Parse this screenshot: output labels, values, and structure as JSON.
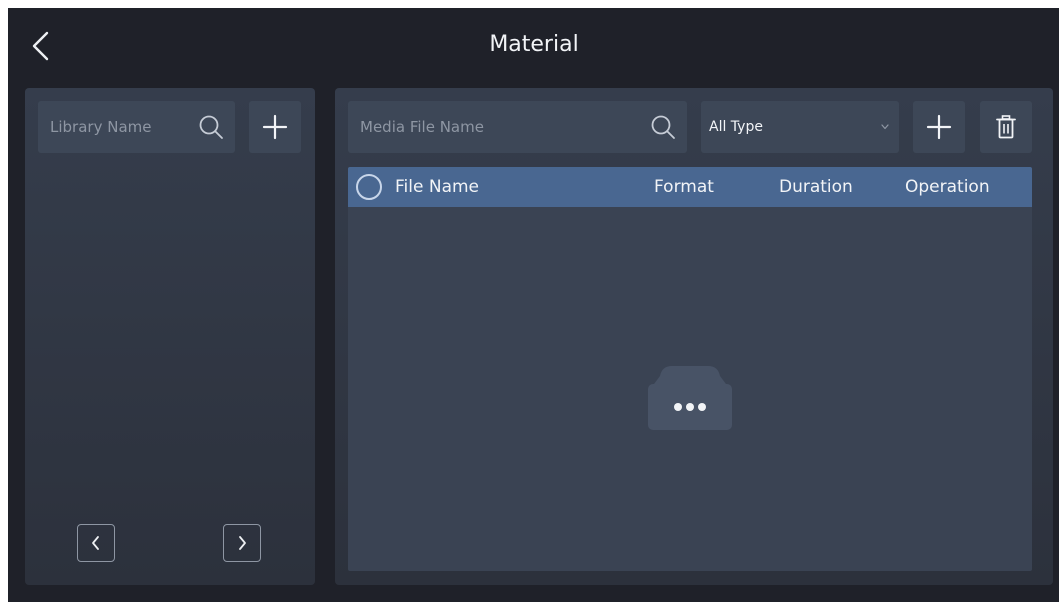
{
  "header": {
    "title": "Material",
    "back_icon": "chevron-left-icon"
  },
  "library": {
    "search_placeholder": "Library Name",
    "search_icon": "search-icon",
    "add_icon": "plus-icon",
    "prev_icon": "chevron-left-icon",
    "next_icon": "chevron-right-icon"
  },
  "media": {
    "search_placeholder": "Media File Name",
    "search_icon": "search-icon",
    "type_filter": {
      "selected": "All Type",
      "icon": "chevron-down-icon"
    },
    "add_icon": "plus-icon",
    "delete_icon": "trash-icon",
    "table": {
      "columns": [
        "File Name",
        "Format",
        "Duration",
        "Operation"
      ],
      "rows": [],
      "empty_icon": "empty-box-icon"
    }
  },
  "colors": {
    "background": "#1f2129",
    "panel": "#353d4c",
    "control": "#3d4757",
    "table_header": "#496791",
    "text": "#f2f4f7",
    "placeholder": "#8e96a3"
  }
}
